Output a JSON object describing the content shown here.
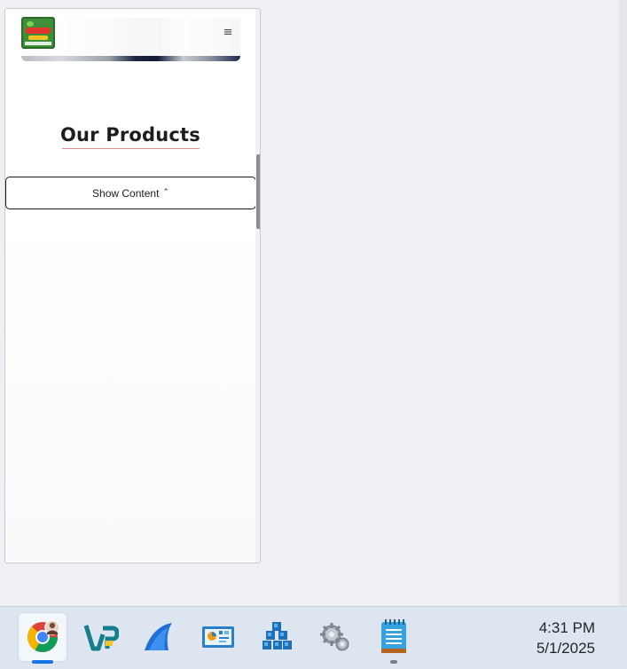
{
  "browser": {
    "header": {
      "logo_alt": "BONITA MARKETS",
      "menu_icon": "hamburger-icon"
    },
    "section": {
      "title": "Our Products"
    },
    "toggle": {
      "label": "Show Content",
      "icon": "chevron-up-icon"
    }
  },
  "taskbar": {
    "apps": [
      {
        "name": "chrome",
        "icon": "chrome-icon",
        "active": true
      },
      {
        "name": "visual-paradigm",
        "icon": "vp-icon"
      },
      {
        "name": "wireshark",
        "icon": "shark-fin-icon"
      },
      {
        "name": "dashboard",
        "icon": "dashboard-icon"
      },
      {
        "name": "cubes",
        "icon": "cubes-icon"
      },
      {
        "name": "settings",
        "icon": "gears-icon"
      },
      {
        "name": "notepad",
        "icon": "notepad-icon",
        "open": true
      }
    ],
    "clock": {
      "time": "4:31 PM",
      "date": "5/1/2025"
    }
  },
  "colors": {
    "title_underline": "#e58a8a",
    "chrome_indicator": "#1a73e8",
    "taskbar_bg": "#dde6f0"
  }
}
